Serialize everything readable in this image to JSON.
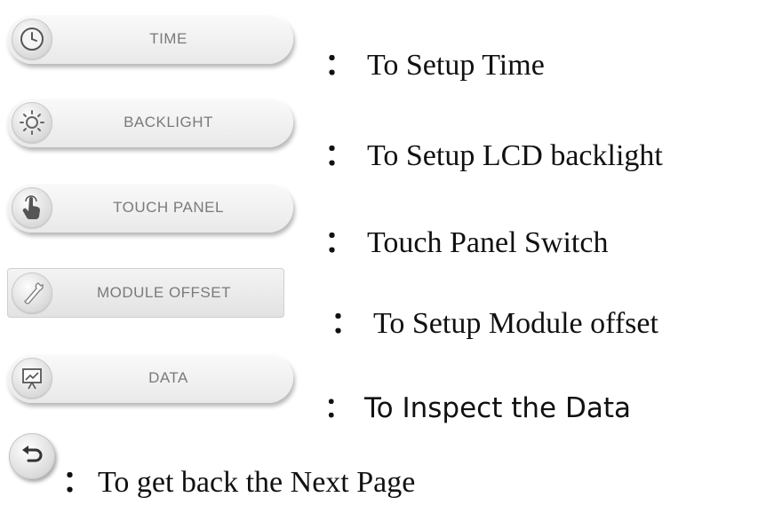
{
  "buttons": [
    {
      "label": "TIME",
      "icon": "clock-icon"
    },
    {
      "label": "BACKLIGHT",
      "icon": "sun-icon"
    },
    {
      "label": "TOUCH PANEL",
      "icon": "hand-touch-icon"
    },
    {
      "label": "MODULE OFFSET",
      "icon": "wrench-icon"
    },
    {
      "label": "DATA",
      "icon": "chart-presentation-icon"
    }
  ],
  "descriptions": [
    {
      "colon": "：",
      "text": "To Setup Time"
    },
    {
      "colon": "：",
      "text": "To Setup LCD backlight"
    },
    {
      "colon": "：",
      "text": "Touch Panel Switch"
    },
    {
      "colon": "：",
      "text": "To Setup Module offset"
    },
    {
      "colon": "：",
      "text": "To Inspect the Data"
    }
  ],
  "back": {
    "icon": "back-arrow-icon",
    "colon": "：",
    "text": "To get back the Next Page"
  }
}
